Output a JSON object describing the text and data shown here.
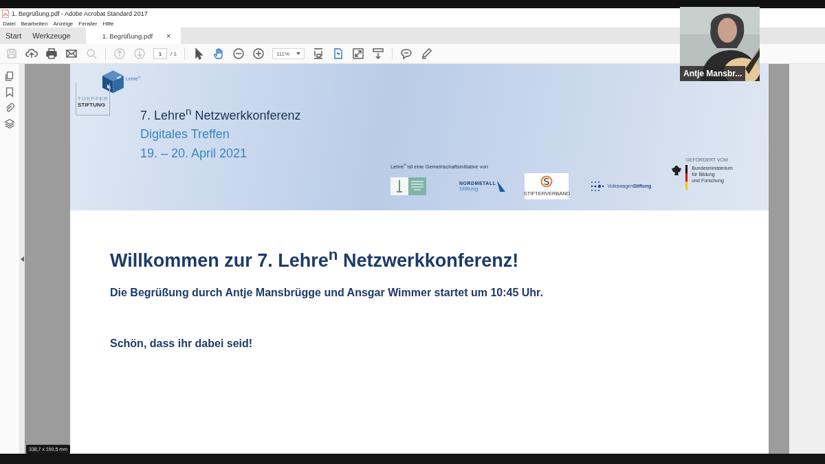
{
  "window": {
    "title": "1. Begrüßung.pdf - Adobe Acrobat Standard 2017"
  },
  "menu": [
    "Datei",
    "Bearbeiten",
    "Anzeige",
    "Fenster",
    "Hilfe"
  ],
  "tabs": [
    {
      "label": "Start",
      "selected": false
    },
    {
      "label": "Werkzeuge",
      "selected": false
    },
    {
      "label": "1. Begrüßung.pdf",
      "selected": true,
      "close": "×"
    }
  ],
  "toolbar": [
    {
      "kind": "save",
      "disabled": true,
      "selected": false
    },
    {
      "kind": "upload",
      "disabled": false,
      "selected": false
    },
    {
      "kind": "print",
      "disabled": false,
      "selected": false
    },
    {
      "kind": "mail",
      "disabled": false,
      "selected": false
    },
    {
      "kind": "search",
      "disabled": true,
      "selected": false
    },
    {
      "kind": "sep"
    },
    {
      "kind": "prev",
      "disabled": true,
      "selected": false
    },
    {
      "kind": "next",
      "disabled": true,
      "selected": false
    },
    {
      "kind": "page",
      "value": "1",
      "total": "/ 1"
    },
    {
      "kind": "sep"
    },
    {
      "kind": "pointer",
      "disabled": false,
      "selected": false
    },
    {
      "kind": "hand",
      "disabled": false,
      "selected": true
    },
    {
      "kind": "zoomout",
      "disabled": false,
      "selected": false
    },
    {
      "kind": "zoomin",
      "disabled": false,
      "selected": false
    },
    {
      "kind": "zoom",
      "value": "111%"
    },
    {
      "kind": "fitpage",
      "disabled": false,
      "selected": false
    },
    {
      "kind": "fitwidth",
      "disabled": false,
      "selected": true
    },
    {
      "kind": "fullscreen",
      "disabled": false,
      "selected": false
    },
    {
      "kind": "scroll",
      "disabled": false,
      "selected": false
    },
    {
      "kind": "sep"
    },
    {
      "kind": "comment",
      "disabled": false,
      "selected": false
    },
    {
      "kind": "pen",
      "disabled": false,
      "selected": false
    }
  ],
  "banner": {
    "logo_label": "Lehre$^{n}$",
    "foundation": [
      "TOEPFER",
      "STIFTUNG"
    ],
    "title": "7. Lehre$^{n}$ Netzwerkkonferenz",
    "subtitle": "Digitales Treffen",
    "dates": "19. – 20. April 2021",
    "initiative": "Lehre$^{n}$ ist eine Gemeinschaftsinitiative von",
    "partners": [
      {
        "kind": "toepfer"
      },
      {
        "kind": "nordmetall",
        "lines": [
          "NORDMETALL",
          "Stiftung"
        ]
      },
      {
        "kind": "stifterverband",
        "lines": [
          "STIFTERVERBAND"
        ]
      },
      {
        "kind": "volkswagen",
        "lines": [
          "Volkswagen**Stiftung**"
        ]
      }
    ],
    "funder": {
      "caption": "GEFÖRDERT VOM",
      "lines": [
        "Bundesministerium",
        "für Bildung",
        "und Forschung"
      ]
    }
  },
  "body": {
    "heading": "Willkommen zur 7. Lehre$^{n}$ Netzwerkkonferenz!",
    "lines": [
      "Die Begrüßung durch Antje Mansbrügge und Ansgar Wimmer startet um 10:45 Uhr.",
      "Schön, dass ihr dabei seid!"
    ]
  },
  "page_size": "338,7 x 190,5 mm",
  "video": {
    "kind": "picture",
    "name": "Antje Mansbr..."
  }
}
